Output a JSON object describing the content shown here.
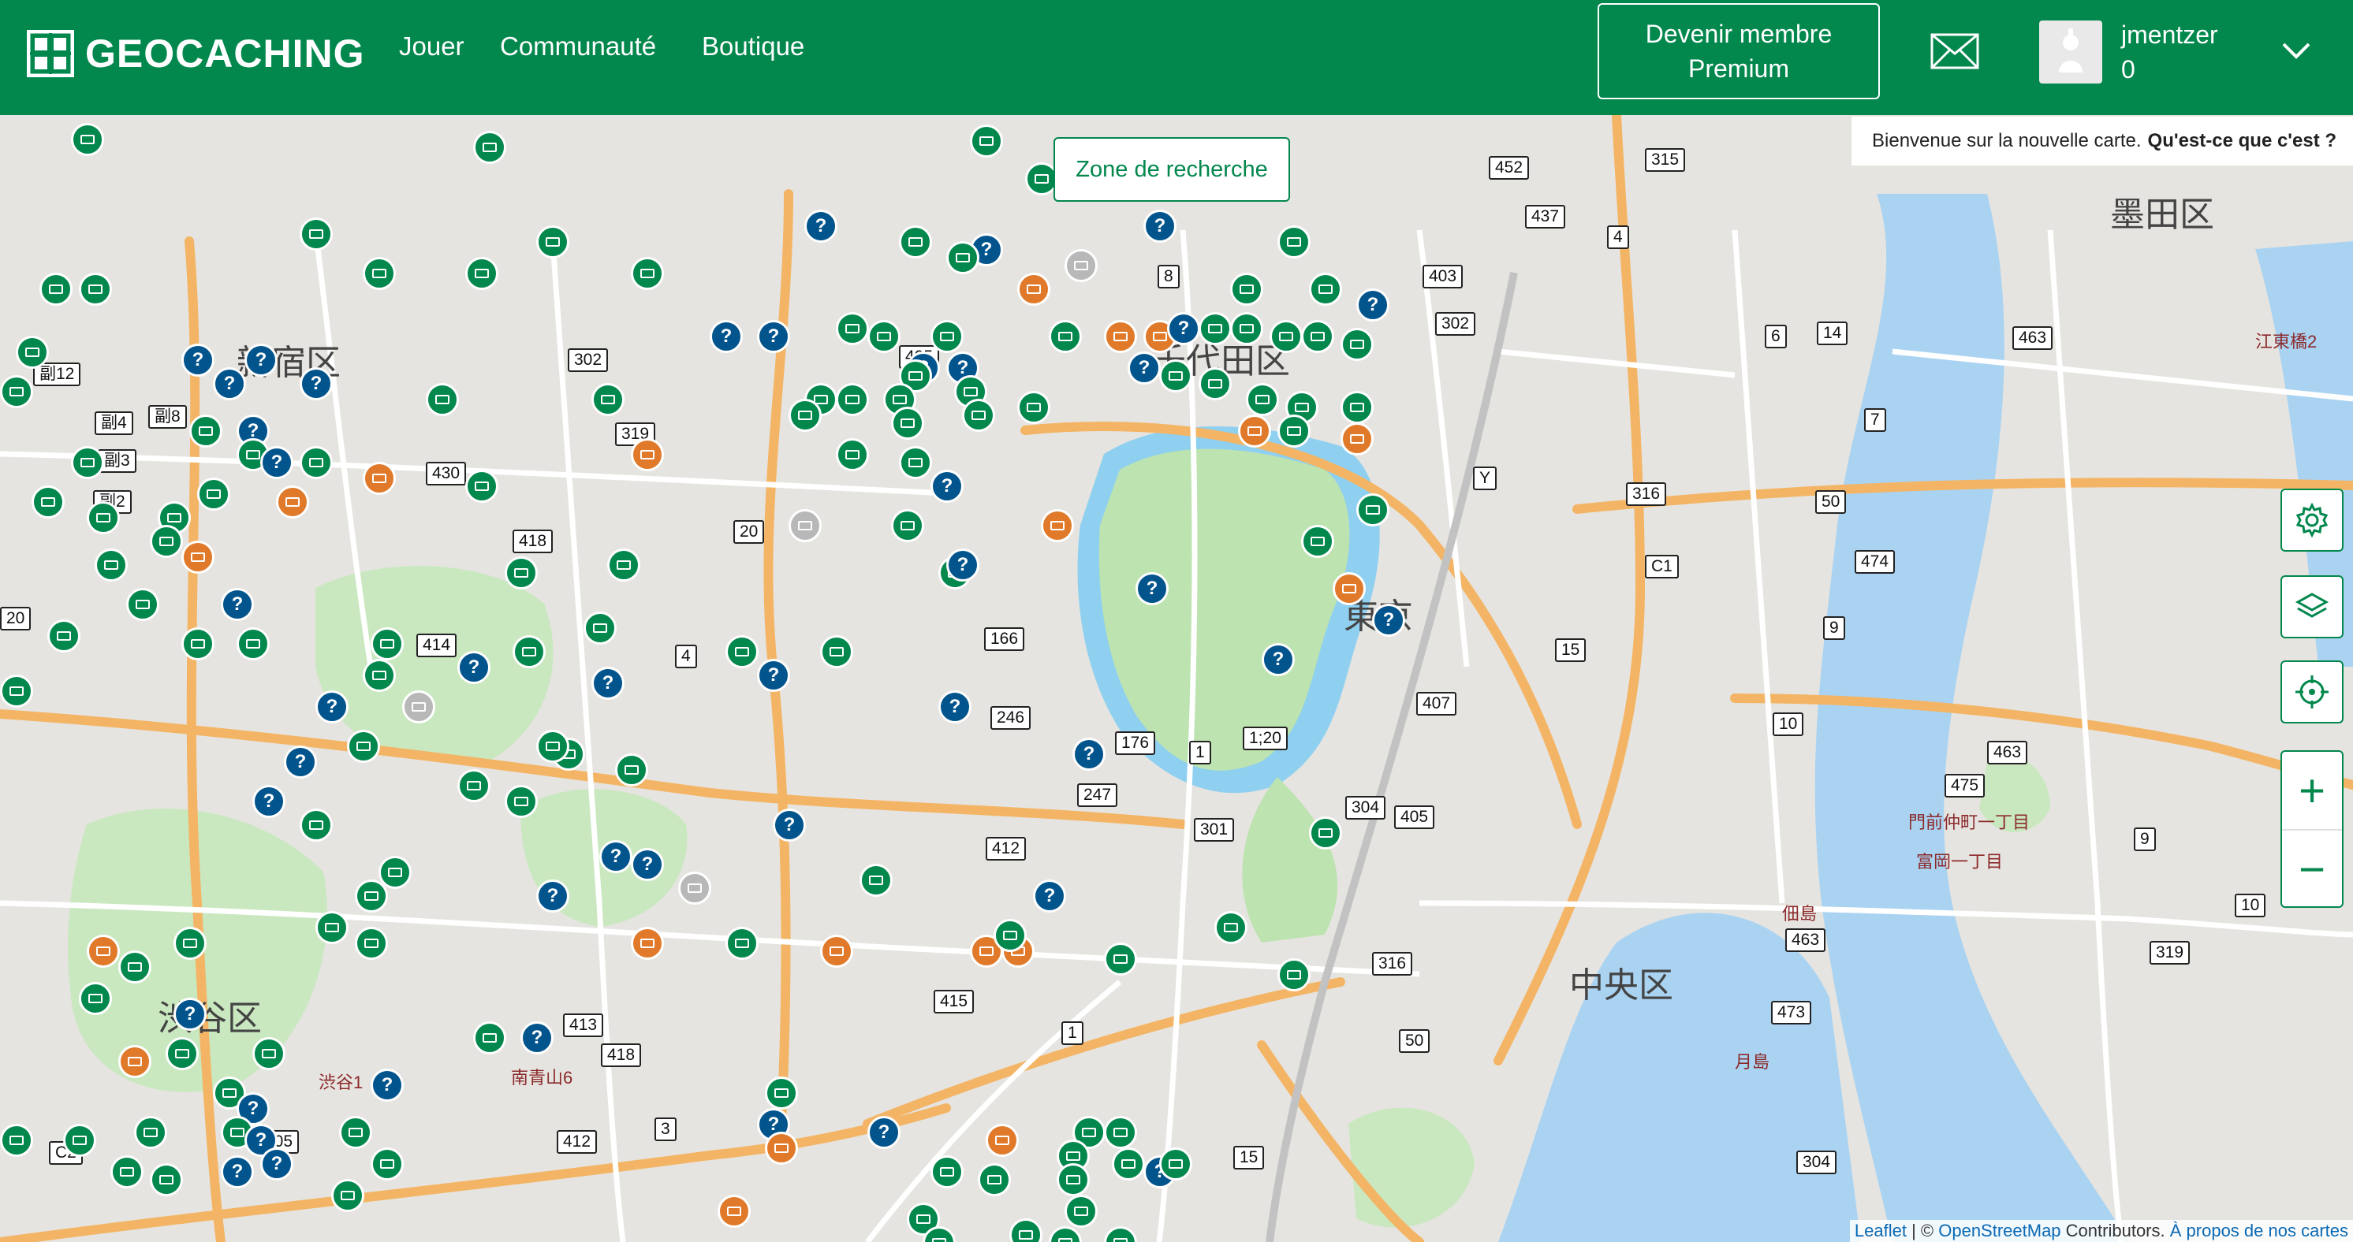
{
  "header": {
    "logo_text": "GEOCACHING",
    "nav": [
      "Jouer",
      "Communauté",
      "Boutique"
    ],
    "premium_line1": "Devenir membre",
    "premium_line2": "Premium",
    "username": "jmentzer",
    "points": "0"
  },
  "map": {
    "welcome_text": "Bienvenue sur la nouvelle carte.",
    "welcome_link": "Qu'est-ce que c'est ?",
    "search_zone_label": "Zone de recherche",
    "zoom_in": "+",
    "zoom_out": "−",
    "attribution": {
      "leaflet": "Leaflet",
      "separator": "| ©",
      "osm": "OpenStreetMap",
      "contributors": "Contributors.",
      "about": "À propos de nos cartes"
    },
    "districts": [
      "新宿区",
      "千代田区",
      "渋谷区",
      "中央区",
      "墨田区",
      "東京"
    ],
    "blocks": [
      "江東橋2",
      "門前仲町一丁目",
      "富岡一丁目",
      "佃島",
      "月島",
      "渋谷1",
      "南青山6"
    ],
    "route_numbers": [
      "452",
      "315",
      "437",
      "403",
      "302",
      "405",
      "302",
      "319",
      "430",
      "418",
      "414",
      "166",
      "246",
      "247",
      "176",
      "1",
      "1;20",
      "301",
      "304",
      "405",
      "412",
      "415",
      "1",
      "413",
      "418",
      "305",
      "412",
      "3",
      "316",
      "50",
      "316",
      "C1",
      "Y",
      "50",
      "474",
      "9",
      "15",
      "407",
      "10",
      "463",
      "475",
      "9",
      "463",
      "473",
      "319",
      "10",
      "304",
      "15",
      "6",
      "14",
      "7",
      "463",
      "4",
      "8",
      "20",
      "4",
      "C2",
      "副12",
      "副4",
      "副8",
      "副3",
      "副2",
      "20",
      "C1"
    ]
  },
  "colors": {
    "brand_green": "#02874d",
    "cache_blue": "#02548d",
    "cache_orange": "#e07a2a",
    "link_blue": "#0a69b4"
  }
}
